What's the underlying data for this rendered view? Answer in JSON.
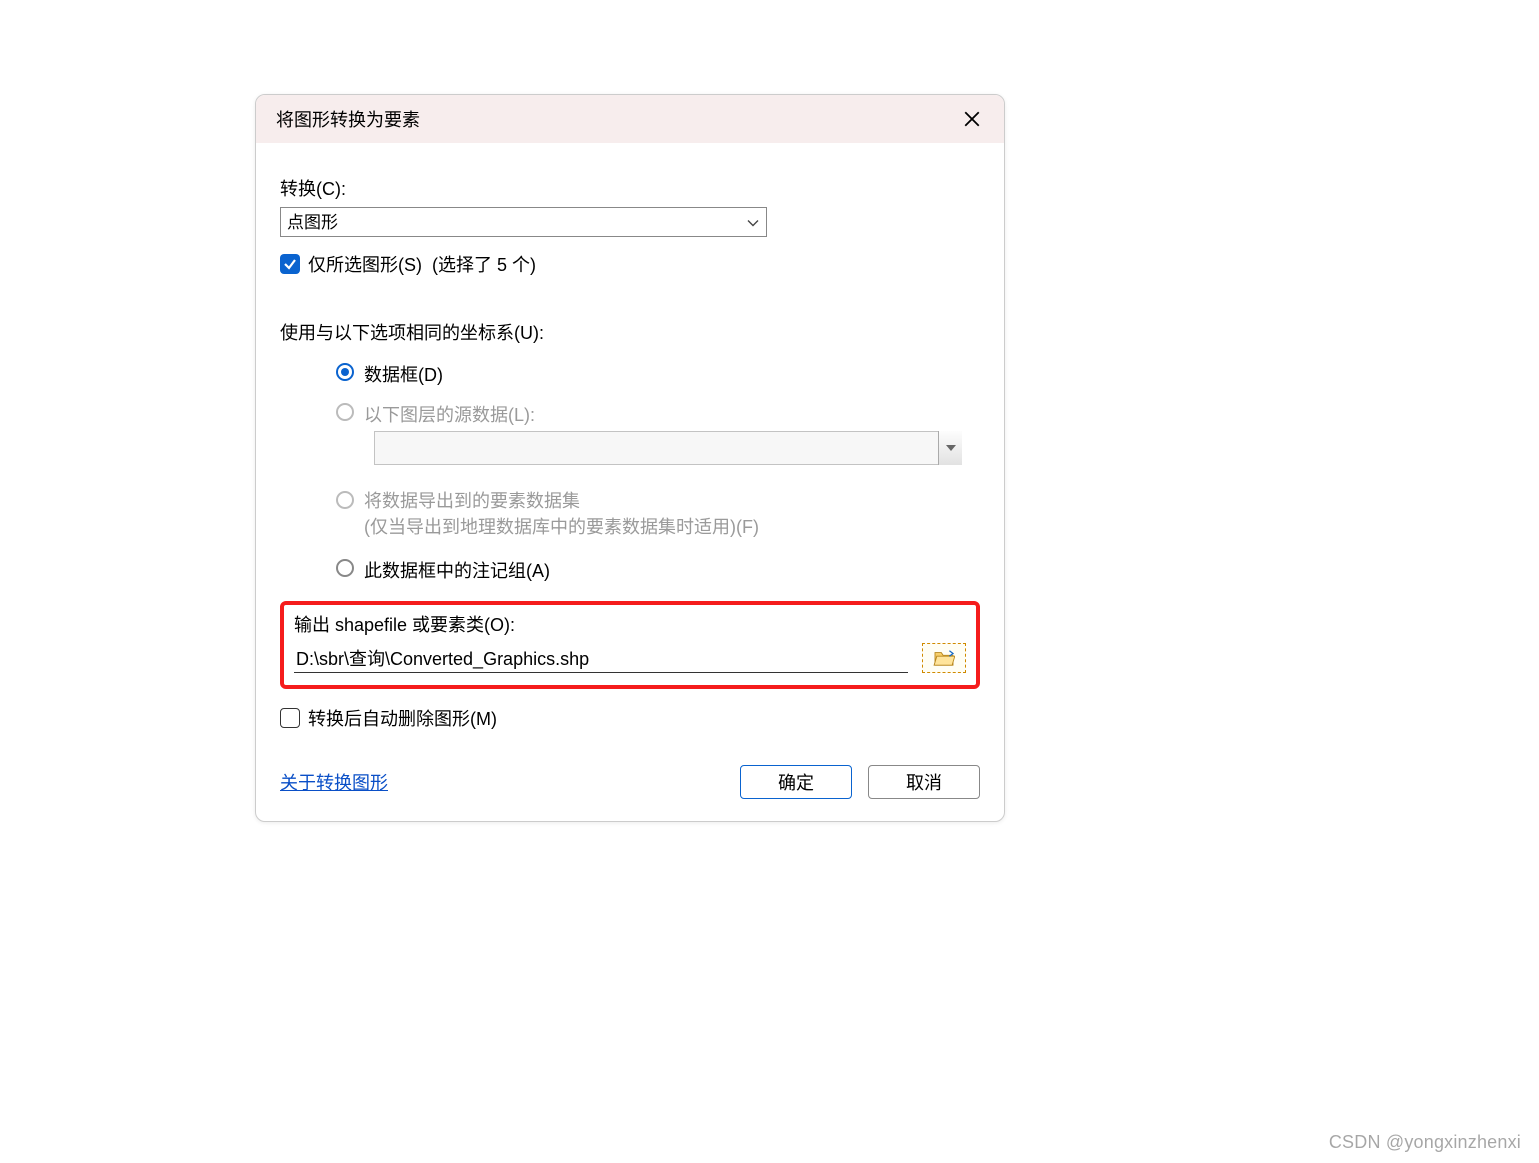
{
  "dialog": {
    "title": "将图形转换为要素",
    "convert": {
      "label": "转换(C):",
      "selected": "点图形"
    },
    "selected_only": {
      "label": "仅所选图形(S)",
      "count_suffix": "(选择了 5 个)",
      "checked": true
    },
    "coord_label": "使用与以下选项相同的坐标系(U):",
    "radios": {
      "data_frame": "数据框(D)",
      "layer_source": "以下图层的源数据(L):",
      "dataset_line1": "将数据导出到的要素数据集",
      "dataset_line2": "(仅当导出到地理数据库中的要素数据集时适用)(F)",
      "anno_group": "此数据框中的注记组(A)",
      "selected": "data_frame"
    },
    "output": {
      "label": "输出 shapefile 或要素类(O):",
      "path": "D:\\sbr\\查询\\Converted_Graphics.shp"
    },
    "delete_after": {
      "label": "转换后自动删除图形(M)",
      "checked": false
    },
    "help_link": "关于转换图形",
    "ok": "确定",
    "cancel": "取消"
  },
  "watermark": "CSDN @yongxinzhenxi"
}
